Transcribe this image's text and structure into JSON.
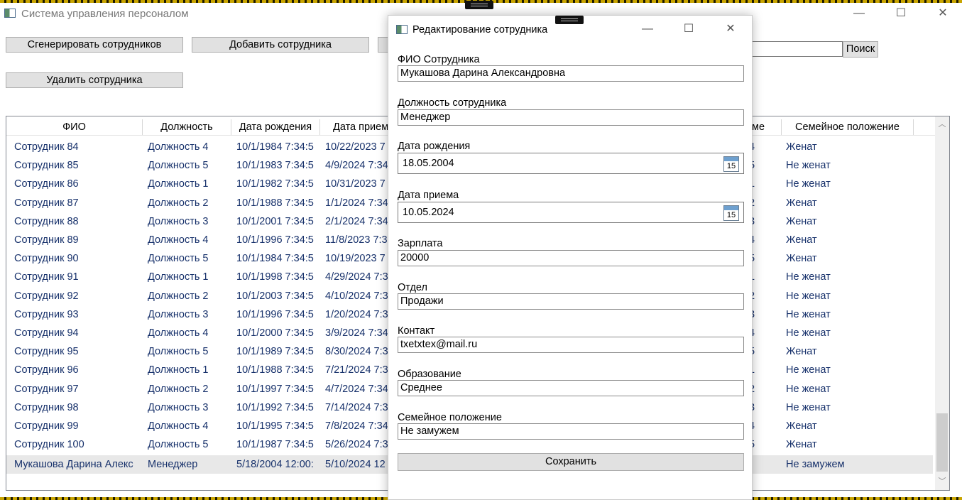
{
  "window": {
    "title": "Система управления персоналом",
    "minimize": "—",
    "maximize": "☐",
    "close": "✕"
  },
  "toolbar": {
    "generate_label": "Сгенерировать сотрудников",
    "add_label": "Добавить сотрудника",
    "delete_label": "Удалить сотрудника",
    "search_label": "Поиск"
  },
  "grid": {
    "columns": [
      "ФИО",
      "Должность",
      "Дата рождения",
      "Дата прием",
      "ме",
      "Семейное положение"
    ],
    "rows": [
      {
        "name": "Сотрудник 84",
        "position": "Должность 4",
        "birth": "10/1/1984 7:34:5",
        "hire": "10/22/2023 7",
        "frag": "4",
        "marital": "Женат"
      },
      {
        "name": "Сотрудник 85",
        "position": "Должность 5",
        "birth": "10/1/1983 7:34:5",
        "hire": "4/9/2024 7:34",
        "frag": "5",
        "marital": "Не женат"
      },
      {
        "name": "Сотрудник 86",
        "position": "Должность 1",
        "birth": "10/1/1982 7:34:5",
        "hire": "10/31/2023 7",
        "frag": "1",
        "marital": "Не женат"
      },
      {
        "name": "Сотрудник 87",
        "position": "Должность 2",
        "birth": "10/1/1988 7:34:5",
        "hire": "1/1/2024 7:34",
        "frag": "2",
        "marital": "Женат"
      },
      {
        "name": "Сотрудник 88",
        "position": "Должность 3",
        "birth": "10/1/2001 7:34:5",
        "hire": "2/1/2024 7:34",
        "frag": "3",
        "marital": "Женат"
      },
      {
        "name": "Сотрудник 89",
        "position": "Должность 4",
        "birth": "10/1/1996 7:34:5",
        "hire": "11/8/2023 7:3",
        "frag": "4",
        "marital": "Женат"
      },
      {
        "name": "Сотрудник 90",
        "position": "Должность 5",
        "birth": "10/1/1984 7:34:5",
        "hire": "10/19/2023 7",
        "frag": "5",
        "marital": "Женат"
      },
      {
        "name": "Сотрудник 91",
        "position": "Должность 1",
        "birth": "10/1/1998 7:34:5",
        "hire": "4/29/2024 7:3",
        "frag": "1",
        "marital": "Не женат"
      },
      {
        "name": "Сотрудник 92",
        "position": "Должность 2",
        "birth": "10/1/2003 7:34:5",
        "hire": "4/10/2024 7:3",
        "frag": "2",
        "marital": "Не женат"
      },
      {
        "name": "Сотрудник 93",
        "position": "Должность 3",
        "birth": "10/1/1996 7:34:5",
        "hire": "1/20/2024 7:3",
        "frag": "3",
        "marital": "Не женат"
      },
      {
        "name": "Сотрудник 94",
        "position": "Должность 4",
        "birth": "10/1/2000 7:34:5",
        "hire": "3/9/2024 7:34",
        "frag": "4",
        "marital": "Не женат"
      },
      {
        "name": "Сотрудник 95",
        "position": "Должность 5",
        "birth": "10/1/1989 7:34:5",
        "hire": "8/30/2024 7:3",
        "frag": "5",
        "marital": "Женат"
      },
      {
        "name": "Сотрудник 96",
        "position": "Должность 1",
        "birth": "10/1/1988 7:34:5",
        "hire": "7/21/2024 7:3",
        "frag": "1",
        "marital": "Не женат"
      },
      {
        "name": "Сотрудник 97",
        "position": "Должность 2",
        "birth": "10/1/1997 7:34:5",
        "hire": "4/7/2024 7:34",
        "frag": "2",
        "marital": "Не женат"
      },
      {
        "name": "Сотрудник 98",
        "position": "Должность 3",
        "birth": "10/1/1992 7:34:5",
        "hire": "7/14/2024 7:3",
        "frag": "3",
        "marital": "Не женат"
      },
      {
        "name": "Сотрудник 99",
        "position": "Должность 4",
        "birth": "10/1/1995 7:34:5",
        "hire": "7/8/2024 7:34",
        "frag": "4",
        "marital": "Женат"
      },
      {
        "name": "Сотрудник 100",
        "position": "Должность 5",
        "birth": "10/1/1987 7:34:5",
        "hire": "5/26/2024 7:3",
        "frag": "5",
        "marital": "Женат"
      },
      {
        "name": "Мукашова Дарина Алекс",
        "position": "Менеджер",
        "birth": "5/18/2004 12:00:",
        "hire": "5/10/2024 12",
        "frag": "",
        "marital": "Не замужем"
      }
    ]
  },
  "dialog": {
    "title": "Редактирование сотрудника",
    "minimize": "—",
    "maximize": "☐",
    "close": "✕",
    "save_label": "Сохранить",
    "calendar_day": "15",
    "fields": {
      "fio": {
        "label": "ФИО Сотрудника",
        "value": "Мукашова Дарина Александровна"
      },
      "position": {
        "label": "Должность сотрудника",
        "value": "Менеджер"
      },
      "birth": {
        "label": "Дата рождения",
        "value": "18.05.2004"
      },
      "hire": {
        "label": "Дата приема",
        "value": "10.05.2024"
      },
      "salary": {
        "label": "Зарплата",
        "value": "20000"
      },
      "department": {
        "label": "Отдел",
        "value": "Продажи"
      },
      "contact": {
        "label": "Контакт",
        "value": "txetxtex@mail.ru"
      },
      "education": {
        "label": "Образование",
        "value": "Среднее"
      },
      "marital": {
        "label": "Семейное положение",
        "value": "Не замужем"
      }
    }
  }
}
